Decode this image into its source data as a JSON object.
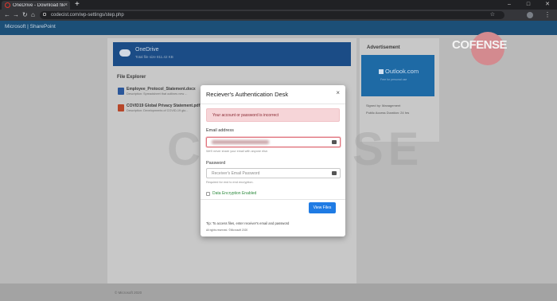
{
  "browser": {
    "tab_title": "OneDrive - Download files",
    "tab_close": "×",
    "new_tab": "+",
    "url": "codecist.com/wp-settings/step.php",
    "back": "←",
    "forward": "→",
    "reload": "↻",
    "home": "⌂",
    "bookmark": "☆",
    "menu": "⋮",
    "minimize": "–",
    "maximize": "□",
    "close": "✕"
  },
  "site": {
    "brand": "Microsoft | SharePoint",
    "onedrive_title": "OneDrive",
    "onedrive_sub": "Total file size 811.42 KB",
    "file_explorer_title": "File Explorer",
    "files": [
      {
        "name": "Employee_Protocol_Statement.docx",
        "desc": "Description: Spreadsheet that outlines new ...",
        "color": "#2b579a"
      },
      {
        "name": "COVID19 Global Privacy Statement.pdf",
        "desc": "Description: Developments of COVID-19 glo...",
        "color": "#b7472a"
      }
    ],
    "advertisement_title": "Advertisement",
    "ad_logo": "Outlook.com",
    "ad_tagline": "Free for personal use",
    "signed_by": "Signed by: Management",
    "access_duration": "Public Access Duration: 24 hrs",
    "footer": "© Microsoft 2020"
  },
  "overlay": {
    "cofense": "COFENSE",
    "cofense_color": "#e0343e",
    "watermark": "COFENSE"
  },
  "modal": {
    "title": "Reciever's Authentication Desk",
    "close": "×",
    "alert": "Your account or password is incorrect",
    "email_label": "Email address",
    "email_help": "We'll never share your email with anyone else.",
    "password_label": "Password",
    "password_placeholder": "Receiver's Email Password",
    "password_help": "Required for end to end encryption.",
    "checkbox_label": "Data Encryption Enabled",
    "button": "View Files",
    "tip": "Tip: To access files, enter receiver's email and password",
    "rights": "All rights reserved. ©Microsoft 2020",
    "accent": "#1f7be4",
    "error_color": "#e0727c"
  }
}
